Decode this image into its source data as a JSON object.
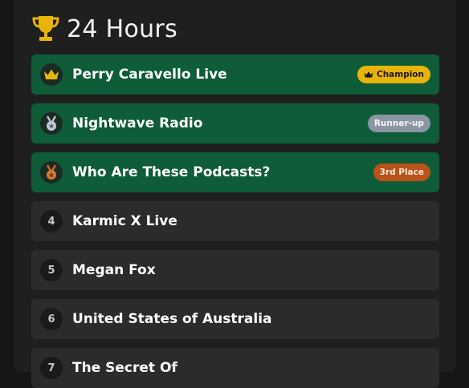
{
  "leaderboard": {
    "title": "24 Hours",
    "rows": [
      {
        "rank": "1",
        "name": "Perry Caravello Live",
        "badge": "Champion",
        "medal": "crown-icon"
      },
      {
        "rank": "2",
        "name": "Nightwave Radio",
        "badge": "Runner-up",
        "medal": "silver-medal-icon"
      },
      {
        "rank": "3",
        "name": "Who Are These Podcasts?",
        "badge": "3rd Place",
        "medal": "bronze-medal-icon"
      },
      {
        "rank": "4",
        "name": "Karmic X Live"
      },
      {
        "rank": "5",
        "name": "Megan Fox"
      },
      {
        "rank": "6",
        "name": "United States of Australia"
      },
      {
        "rank": "7",
        "name": "The Secret Of"
      }
    ]
  },
  "colors": {
    "highlight_row": "#0f5c39",
    "normal_row": "#2b2b2b",
    "gold": "#e8b40c",
    "silver": "#8c95a4",
    "bronze": "#b9531a"
  }
}
